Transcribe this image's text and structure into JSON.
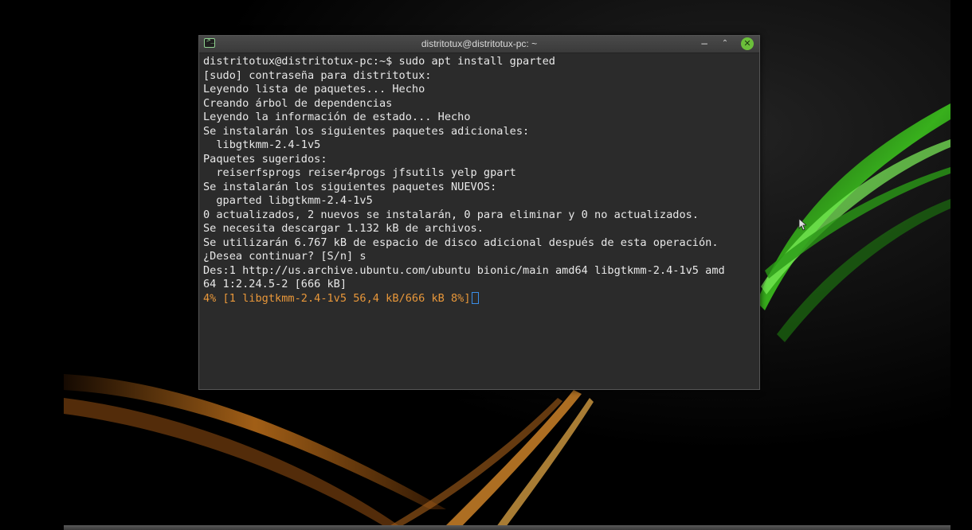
{
  "window": {
    "title": "distritotux@distritotux-pc: ~",
    "app_icon_glyph": ">_",
    "minimize_glyph": "−",
    "maximize_glyph": "⌃",
    "close_glyph": "✕"
  },
  "terminal": {
    "lines": [
      "distritotux@distritotux-pc:~$ sudo apt install gparted",
      "[sudo] contraseña para distritotux:",
      "Leyendo lista de paquetes... Hecho",
      "Creando árbol de dependencias",
      "Leyendo la información de estado... Hecho",
      "Se instalarán los siguientes paquetes adicionales:",
      "  libgtkmm-2.4-1v5",
      "Paquetes sugeridos:",
      "  reiserfsprogs reiser4progs jfsutils yelp gpart",
      "Se instalarán los siguientes paquetes NUEVOS:",
      "  gparted libgtkmm-2.4-1v5",
      "0 actualizados, 2 nuevos se instalarán, 0 para eliminar y 0 no actualizados.",
      "Se necesita descargar 1.132 kB de archivos.",
      "Se utilizarán 6.767 kB de espacio de disco adicional después de esta operación.",
      "¿Desea continuar? [S/n] s",
      "Des:1 http://us.archive.ubuntu.com/ubuntu bionic/main amd64 libgtkmm-2.4-1v5 amd",
      "64 1:2.24.5-2 [666 kB]"
    ],
    "progress_line": "4% [1 libgtkmm-2.4-1v5 56,4 kB/666 kB 8%]"
  },
  "colors": {
    "terminal_bg": "#2b2b2b",
    "terminal_fg": "#e8e8e8",
    "progress_fg": "#e8973a",
    "cursor": "#3a8ee8",
    "close_button": "#6bbf3a"
  }
}
